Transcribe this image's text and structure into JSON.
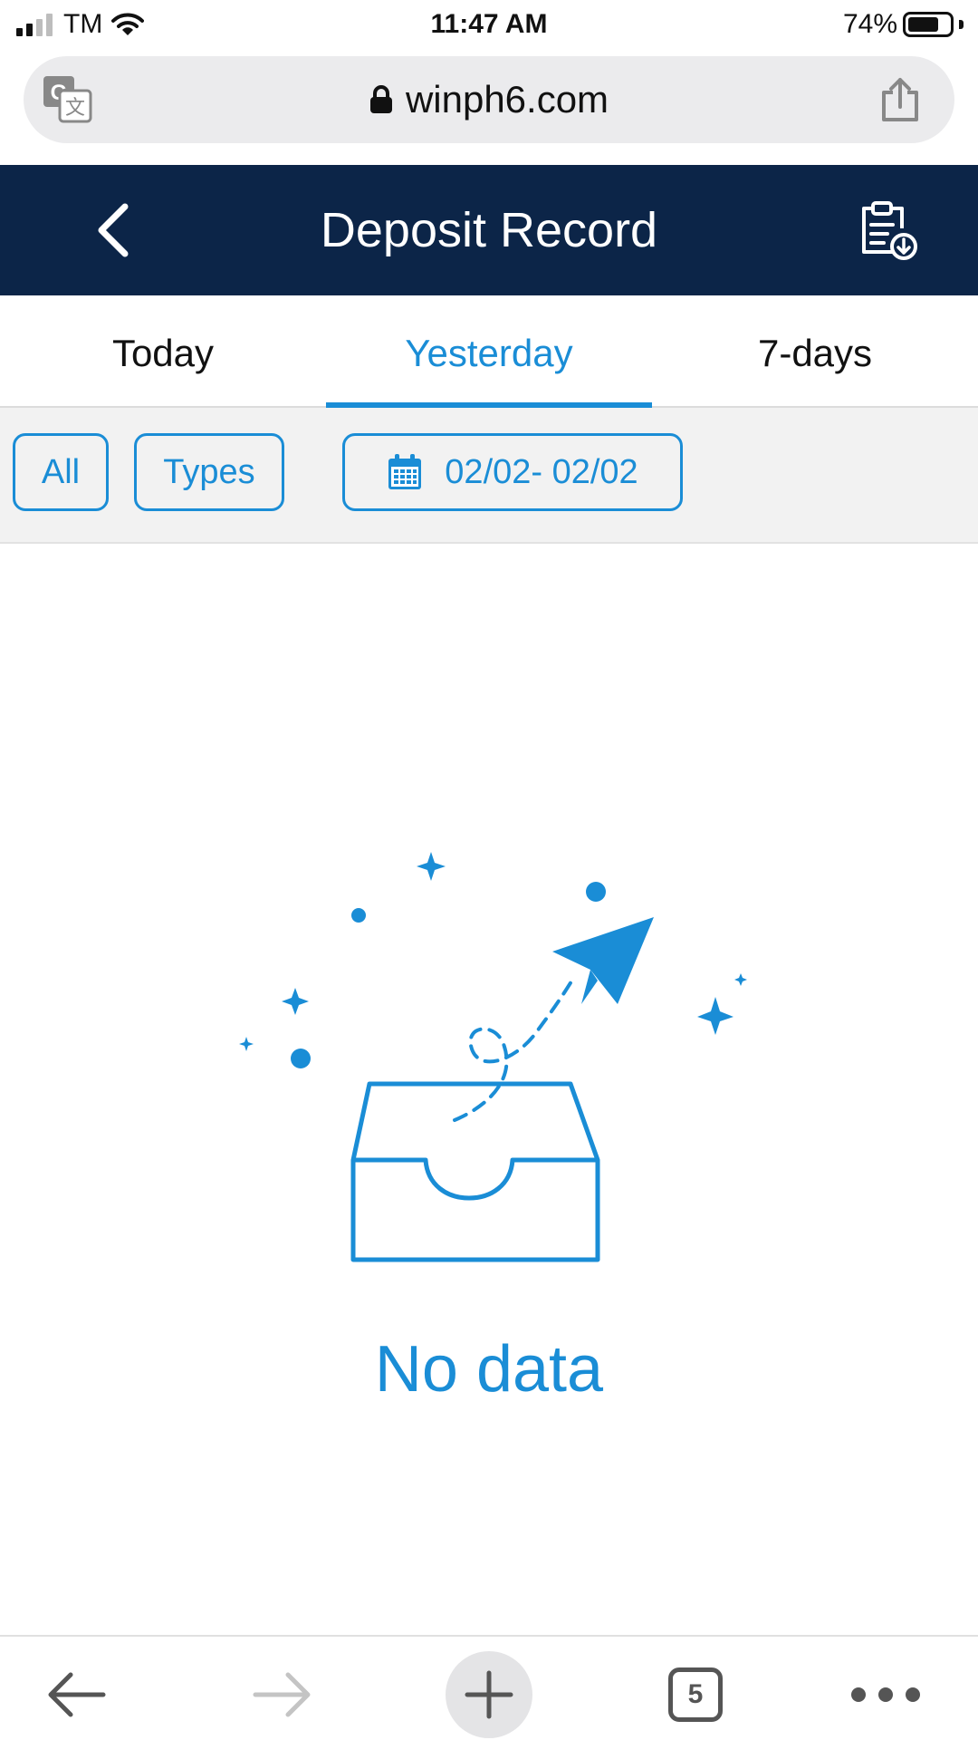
{
  "status_bar": {
    "carrier": "TM",
    "time": "11:47 AM",
    "battery": "74%",
    "battery_level": 0.74,
    "signal_bars_active": 2,
    "icons": [
      "signal-icon",
      "wifi-icon",
      "battery-icon"
    ]
  },
  "browser": {
    "url": "winph6.com",
    "icons": [
      "translate-icon",
      "lock-icon",
      "share-icon"
    ]
  },
  "header": {
    "title": "Deposit Record",
    "icons": [
      "back-arrow-icon",
      "clipboard-download-icon"
    ],
    "background": "#0c2548"
  },
  "tabs": [
    {
      "label": "Today",
      "active": false
    },
    {
      "label": "Yesterday",
      "active": true
    },
    {
      "label": "7-days",
      "active": false
    }
  ],
  "filters": {
    "all_label": "All",
    "types_label": "Types",
    "date_range": "02/02- 02/02",
    "icons": [
      "calendar-icon"
    ]
  },
  "empty_state": {
    "text": "No data",
    "icons": [
      "empty-inbox-icon",
      "paper-plane-icon"
    ]
  },
  "toolbar": {
    "tab_count": "5",
    "icons": [
      "back-arrow-icon",
      "forward-arrow-icon",
      "plus-icon",
      "tabs-icon",
      "more-icon"
    ]
  },
  "colors": {
    "accent": "#1a8dd6",
    "header": "#0c2548",
    "filter_bg": "#f2f2f2"
  }
}
